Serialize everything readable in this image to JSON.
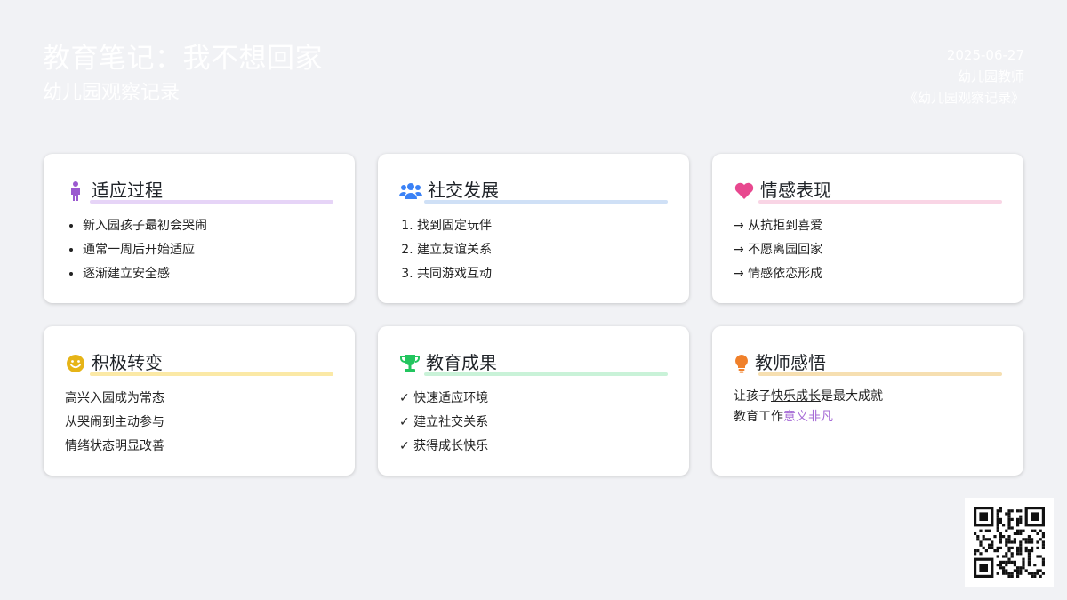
{
  "header": {
    "title": "教育笔记：我不想回家",
    "subtitle": "幼儿园观察记录",
    "date": "2025-06-27",
    "author": "幼儿园教师",
    "source": "《幼儿园观察记录》"
  },
  "cards": [
    {
      "title": "适应过程",
      "icon": "child-icon",
      "accent": "#e6d4f7",
      "items": [
        "新入园孩子最初会哭闹",
        "通常一周后开始适应",
        "逐渐建立安全感"
      ]
    },
    {
      "title": "社交发展",
      "icon": "users-icon",
      "accent": "#cfe0f6",
      "items": [
        "找到固定玩伴",
        "建立友谊关系",
        "共同游戏互动"
      ]
    },
    {
      "title": "情感表现",
      "icon": "heart-icon",
      "accent": "#f9d5e5",
      "items": [
        "→ 从抗拒到喜爱",
        "→ 不愿离园回家",
        "→ 情感依恋形成"
      ]
    },
    {
      "title": "积极转变",
      "icon": "smile-icon",
      "accent": "#fbe9a6",
      "items": [
        "高兴入园成为常态",
        "从哭闹到主动参与",
        "情绪状态明显改善"
      ]
    },
    {
      "title": "教育成果",
      "icon": "trophy-icon",
      "accent": "#c9f2d8",
      "items": [
        "✓ 快速适应环境",
        "✓ 建立社交关系",
        "✓ 获得成长快乐"
      ]
    },
    {
      "title": "教师感悟",
      "icon": "lightbulb-icon",
      "accent": "#f6dfb1",
      "line1": {
        "pre": "让孩子",
        "em": "快乐成长",
        "post": "是最大成就"
      },
      "line2": {
        "pre": "教育工作",
        "em": "意义非凡"
      }
    }
  ],
  "colors": {
    "child": "#9b59d0",
    "users": "#3b82f6",
    "heart": "#e8488f",
    "smile": "#e6b417",
    "trophy": "#22c55e",
    "bulb": "#f0802a"
  }
}
